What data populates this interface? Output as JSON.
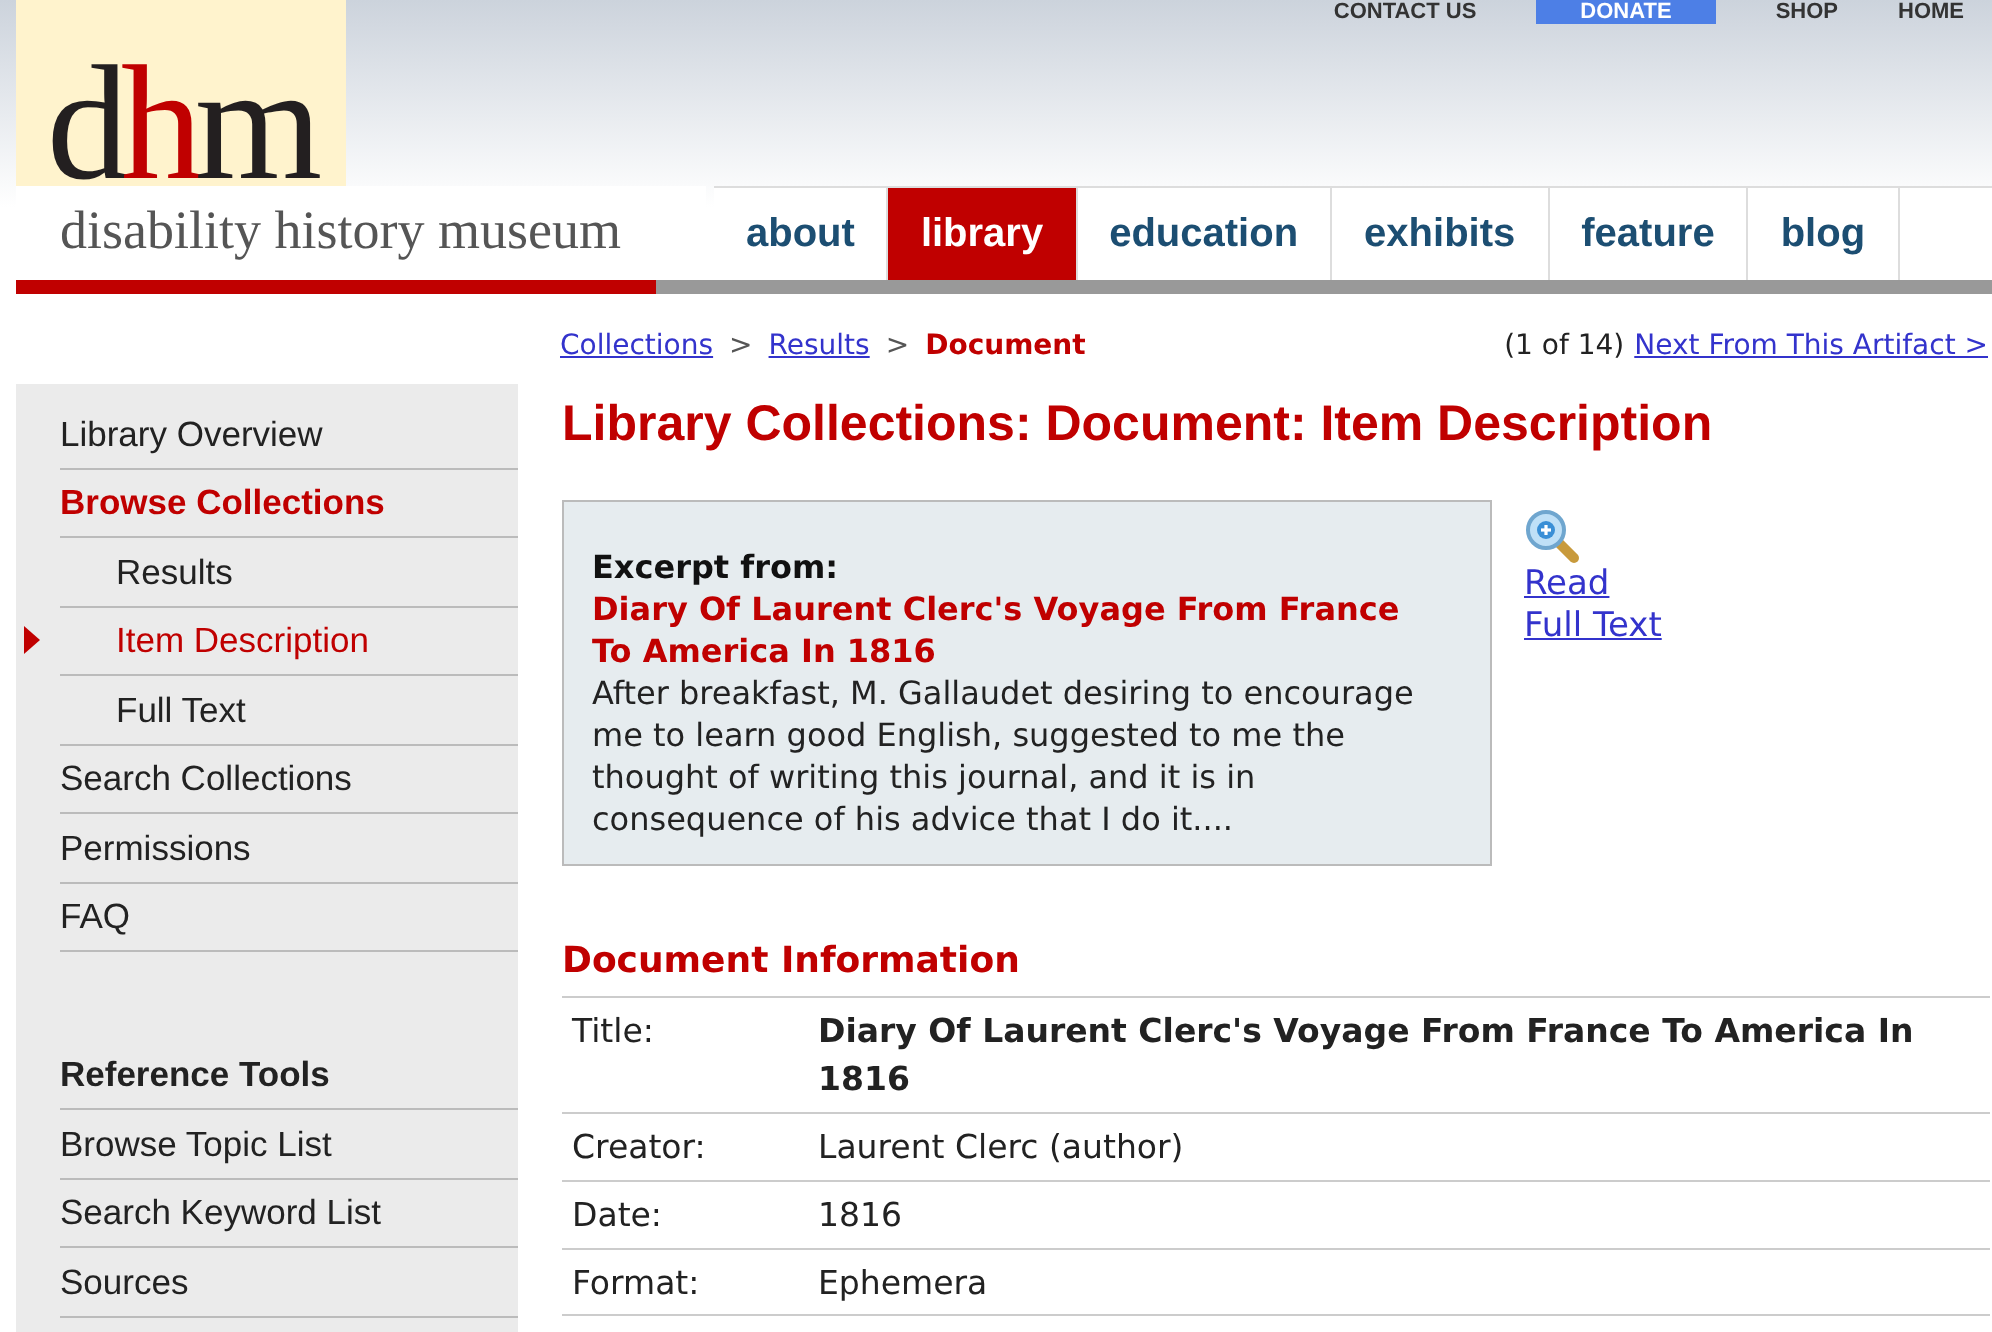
{
  "utility_links": [
    {
      "label": "CONTACT US",
      "kind": "link"
    },
    {
      "label": "DONATE",
      "kind": "button"
    },
    {
      "label": "SHOP",
      "kind": "link"
    },
    {
      "label": "HOME",
      "kind": "link"
    }
  ],
  "logo": {
    "mark_left": "d",
    "mark_middle": "h",
    "mark_right": "m",
    "name": "disability history museum"
  },
  "tabs": [
    {
      "label": "about",
      "selected": false
    },
    {
      "label": "library",
      "selected": true
    },
    {
      "label": "education",
      "selected": false
    },
    {
      "label": "exhibits",
      "selected": false
    },
    {
      "label": "feature",
      "selected": false
    },
    {
      "label": "blog",
      "selected": false
    }
  ],
  "breadcrumb": [
    {
      "label": "Collections",
      "kind": "link"
    },
    {
      "label": ">",
      "kind": "sep"
    },
    {
      "label": "Results",
      "kind": "link"
    },
    {
      "label": ">",
      "kind": "sep"
    },
    {
      "label": "Document",
      "kind": "current"
    }
  ],
  "pager": {
    "count": "(1 of 14)",
    "next": "Next From This Artifact >"
  },
  "sidebar": {
    "items": [
      {
        "label": "Library Overview",
        "selected": false
      },
      {
        "label": "Browse Collections",
        "selected": true,
        "children": [
          {
            "label": "Results",
            "selected": false
          },
          {
            "label": "Item Description",
            "selected": true
          },
          {
            "label": "Full Text",
            "selected": false
          }
        ]
      },
      {
        "label": "Search Collections",
        "selected": false
      },
      {
        "label": "Permissions",
        "selected": false
      },
      {
        "label": "FAQ",
        "selected": false
      }
    ],
    "reference_title": "Reference Tools",
    "reference_items": [
      {
        "label": "Browse Topic List"
      },
      {
        "label": "Search Keyword List"
      },
      {
        "label": "Sources"
      }
    ]
  },
  "page_title": "Library Collections: Document: Item Description",
  "excerpt": {
    "label": "Excerpt from:",
    "title": "Diary Of Laurent Clerc's Voyage From France To America In 1816",
    "text": "After breakfast, M. Gallaudet desiring to encourage me to learn good English, suggested to me the thought of writing this journal, and it is in consequence of his advice that I do it...."
  },
  "read_link": [
    "Read",
    "Full Text"
  ],
  "info_title": "Document Information",
  "info_rows": [
    {
      "label": "Title:",
      "value": "Diary Of Laurent Clerc's Voyage From France To America In 1816",
      "kind": "bold"
    },
    {
      "label": "Creator:",
      "value": "Laurent Clerc (author)",
      "kind": "plain"
    },
    {
      "label": "Date:",
      "value": "1816",
      "kind": "plain"
    },
    {
      "label": "Format:",
      "value": "Ephemera",
      "kind": "plain"
    }
  ]
}
